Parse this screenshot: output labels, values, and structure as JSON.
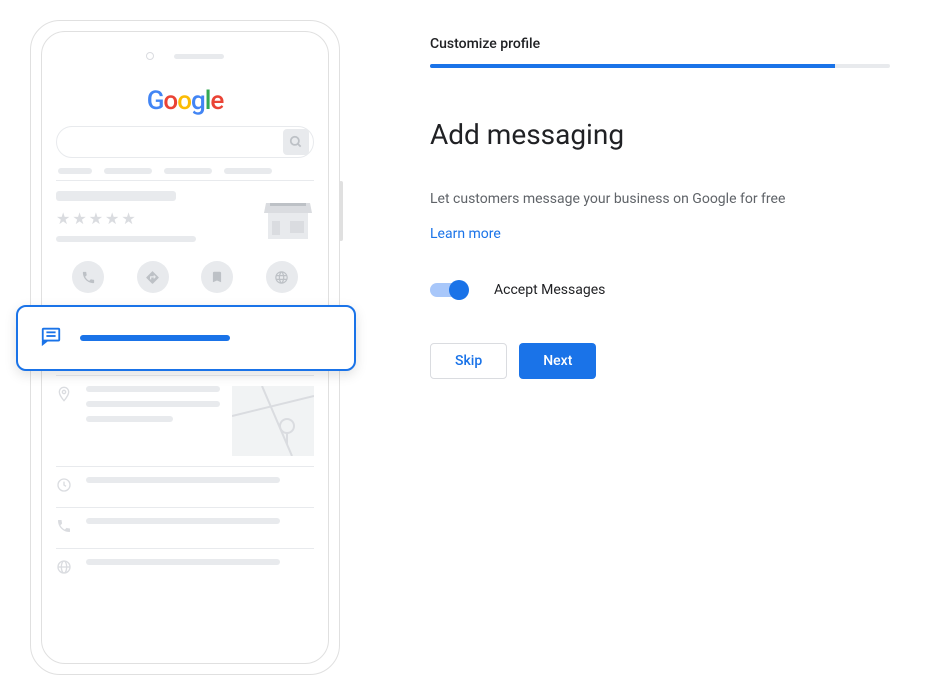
{
  "header": {
    "step_label": "Customize profile",
    "progress_percent": 88
  },
  "main": {
    "title": "Add messaging",
    "description": "Let customers message your business on Google for free",
    "learn_more": "Learn more",
    "toggle_label": "Accept Messages",
    "toggle_on": true
  },
  "buttons": {
    "skip": "Skip",
    "next": "Next"
  },
  "phone": {
    "logo": "Google"
  }
}
